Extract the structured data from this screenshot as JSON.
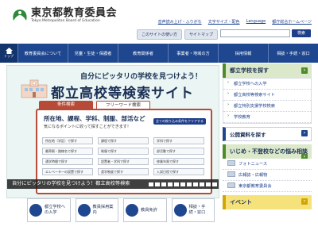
{
  "header": {
    "org_name": "東京都教育委員会",
    "org_name_en": "Tokyo Metropolitan Board of Education",
    "links": [
      "音声読み上げ・ふりがな",
      "文字サイズ・配色",
      "Language",
      "都庁総合ホームページ"
    ],
    "pills": [
      "このサイトの使い方",
      "サイトマップ"
    ],
    "search_placeholder": "",
    "search_button": "検索"
  },
  "nav": {
    "home_label": "トップ",
    "items": [
      "教育委員会について",
      "児童・生徒・保護者",
      "教育関係者",
      "事業者・地域の方",
      "採用情報",
      "相談・手続・窓口"
    ]
  },
  "banner": {
    "subtitle": "自分にピッタリの学校を見つけよう！",
    "title": "都立高校等検索サイト",
    "tab_active": "条件検索",
    "tab_inactive": "フリーワード検索",
    "panel_heading_line1": "所在地、課程、学科、制服、部活など",
    "panel_heading_line2": "気になるポイントに絞って探すことができます！",
    "clear_button": "全ての絞り込み条件をクリアする",
    "categories": [
      "所在地（学区）で探す",
      "課程で探す",
      "学科で探す",
      "最寄駅・路線名で探す",
      "制服で探す",
      "部活動で探す",
      "通学時間で探す",
      "設置者・学科で探す",
      "修業年限で探す",
      "エレベーターの設置で探す",
      "奨学制度で探す",
      "入試日程で探す"
    ],
    "ticker": "自分にピッタリの学校を見つけよう！都立高校等検索"
  },
  "cards": [
    {
      "label": "都立学校への入学",
      "icon": "school-icon"
    },
    {
      "label": "教員採用案内",
      "icon": "teacher-icon"
    },
    {
      "label": "教員免許",
      "icon": "license-icon"
    },
    {
      "label": "相談・手続・窓口",
      "icon": "counter-icon"
    }
  ],
  "sidebar": {
    "find_school": "都立学校を探す",
    "find_items": [
      "都立学校への入学",
      "都立高校等検索サイト",
      "都立特別支援学校検索",
      "学校教育"
    ],
    "publications": "公開資料を探す",
    "bullying": "いじめ・不登校などの悩み相談",
    "links": [
      "フォトニュース",
      "広報誌・広報物",
      "東京都教育委員会"
    ],
    "event": "イベント"
  },
  "colors": {
    "nav": "#1f4790",
    "accent_red": "#b84b37",
    "side_green": "#4e8c2a",
    "event_yellow": "#f6e27a"
  }
}
